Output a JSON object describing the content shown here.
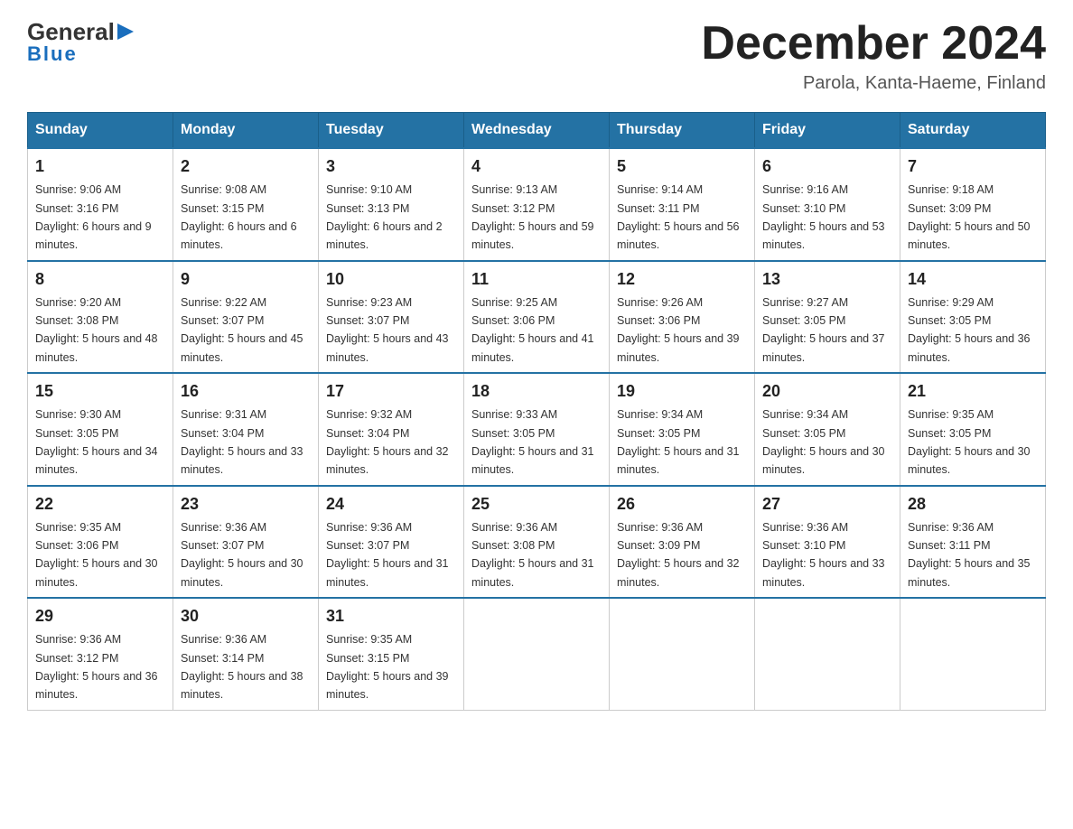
{
  "logo": {
    "general": "General",
    "triangle": "",
    "blue_underline": "Blue"
  },
  "title": "December 2024",
  "location": "Parola, Kanta-Haeme, Finland",
  "days_of_week": [
    "Sunday",
    "Monday",
    "Tuesday",
    "Wednesday",
    "Thursday",
    "Friday",
    "Saturday"
  ],
  "weeks": [
    [
      {
        "day": "1",
        "sunrise": "9:06 AM",
        "sunset": "3:16 PM",
        "daylight": "6 hours and 9 minutes."
      },
      {
        "day": "2",
        "sunrise": "9:08 AM",
        "sunset": "3:15 PM",
        "daylight": "6 hours and 6 minutes."
      },
      {
        "day": "3",
        "sunrise": "9:10 AM",
        "sunset": "3:13 PM",
        "daylight": "6 hours and 2 minutes."
      },
      {
        "day": "4",
        "sunrise": "9:13 AM",
        "sunset": "3:12 PM",
        "daylight": "5 hours and 59 minutes."
      },
      {
        "day": "5",
        "sunrise": "9:14 AM",
        "sunset": "3:11 PM",
        "daylight": "5 hours and 56 minutes."
      },
      {
        "day": "6",
        "sunrise": "9:16 AM",
        "sunset": "3:10 PM",
        "daylight": "5 hours and 53 minutes."
      },
      {
        "day": "7",
        "sunrise": "9:18 AM",
        "sunset": "3:09 PM",
        "daylight": "5 hours and 50 minutes."
      }
    ],
    [
      {
        "day": "8",
        "sunrise": "9:20 AM",
        "sunset": "3:08 PM",
        "daylight": "5 hours and 48 minutes."
      },
      {
        "day": "9",
        "sunrise": "9:22 AM",
        "sunset": "3:07 PM",
        "daylight": "5 hours and 45 minutes."
      },
      {
        "day": "10",
        "sunrise": "9:23 AM",
        "sunset": "3:07 PM",
        "daylight": "5 hours and 43 minutes."
      },
      {
        "day": "11",
        "sunrise": "9:25 AM",
        "sunset": "3:06 PM",
        "daylight": "5 hours and 41 minutes."
      },
      {
        "day": "12",
        "sunrise": "9:26 AM",
        "sunset": "3:06 PM",
        "daylight": "5 hours and 39 minutes."
      },
      {
        "day": "13",
        "sunrise": "9:27 AM",
        "sunset": "3:05 PM",
        "daylight": "5 hours and 37 minutes."
      },
      {
        "day": "14",
        "sunrise": "9:29 AM",
        "sunset": "3:05 PM",
        "daylight": "5 hours and 36 minutes."
      }
    ],
    [
      {
        "day": "15",
        "sunrise": "9:30 AM",
        "sunset": "3:05 PM",
        "daylight": "5 hours and 34 minutes."
      },
      {
        "day": "16",
        "sunrise": "9:31 AM",
        "sunset": "3:04 PM",
        "daylight": "5 hours and 33 minutes."
      },
      {
        "day": "17",
        "sunrise": "9:32 AM",
        "sunset": "3:04 PM",
        "daylight": "5 hours and 32 minutes."
      },
      {
        "day": "18",
        "sunrise": "9:33 AM",
        "sunset": "3:05 PM",
        "daylight": "5 hours and 31 minutes."
      },
      {
        "day": "19",
        "sunrise": "9:34 AM",
        "sunset": "3:05 PM",
        "daylight": "5 hours and 31 minutes."
      },
      {
        "day": "20",
        "sunrise": "9:34 AM",
        "sunset": "3:05 PM",
        "daylight": "5 hours and 30 minutes."
      },
      {
        "day": "21",
        "sunrise": "9:35 AM",
        "sunset": "3:05 PM",
        "daylight": "5 hours and 30 minutes."
      }
    ],
    [
      {
        "day": "22",
        "sunrise": "9:35 AM",
        "sunset": "3:06 PM",
        "daylight": "5 hours and 30 minutes."
      },
      {
        "day": "23",
        "sunrise": "9:36 AM",
        "sunset": "3:07 PM",
        "daylight": "5 hours and 30 minutes."
      },
      {
        "day": "24",
        "sunrise": "9:36 AM",
        "sunset": "3:07 PM",
        "daylight": "5 hours and 31 minutes."
      },
      {
        "day": "25",
        "sunrise": "9:36 AM",
        "sunset": "3:08 PM",
        "daylight": "5 hours and 31 minutes."
      },
      {
        "day": "26",
        "sunrise": "9:36 AM",
        "sunset": "3:09 PM",
        "daylight": "5 hours and 32 minutes."
      },
      {
        "day": "27",
        "sunrise": "9:36 AM",
        "sunset": "3:10 PM",
        "daylight": "5 hours and 33 minutes."
      },
      {
        "day": "28",
        "sunrise": "9:36 AM",
        "sunset": "3:11 PM",
        "daylight": "5 hours and 35 minutes."
      }
    ],
    [
      {
        "day": "29",
        "sunrise": "9:36 AM",
        "sunset": "3:12 PM",
        "daylight": "5 hours and 36 minutes."
      },
      {
        "day": "30",
        "sunrise": "9:36 AM",
        "sunset": "3:14 PM",
        "daylight": "5 hours and 38 minutes."
      },
      {
        "day": "31",
        "sunrise": "9:35 AM",
        "sunset": "3:15 PM",
        "daylight": "5 hours and 39 minutes."
      },
      null,
      null,
      null,
      null
    ]
  ]
}
